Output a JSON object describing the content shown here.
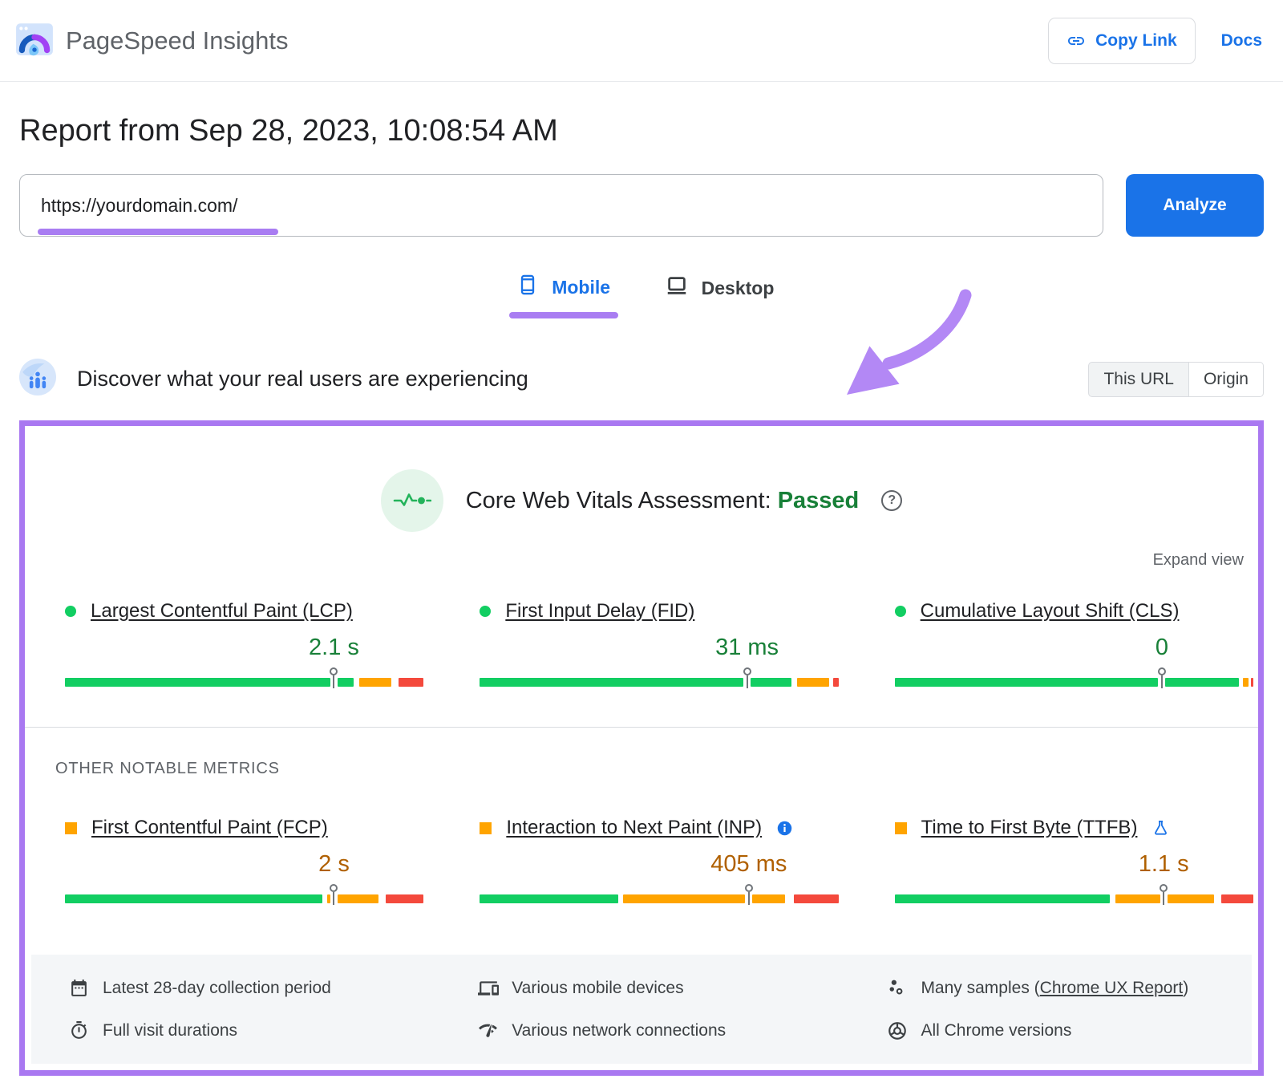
{
  "colors": {
    "accent_blue": "#1a73e8",
    "good_green": "#12ce62",
    "value_green": "#188038",
    "warn_orange": "#ffa400",
    "value_orange": "#b06000",
    "poor_red": "#f4493c",
    "annotation_purple": "#a97df2",
    "panel_border_purple": "#a978f1"
  },
  "header": {
    "app_title": "PageSpeed Insights",
    "copy_link_label": "Copy Link",
    "docs_label": "Docs"
  },
  "report": {
    "title": "Report from Sep 28, 2023, 10:08:54 AM",
    "url_value": "https://yourdomain.com/",
    "analyze_label": "Analyze"
  },
  "tabs": {
    "mobile_label": "Mobile",
    "desktop_label": "Desktop",
    "selected": "Mobile"
  },
  "discover": {
    "heading": "Discover what your real users are experiencing",
    "scope_this_url": "This URL",
    "scope_origin": "Origin",
    "selected_scope": "This URL"
  },
  "assessment": {
    "title": "Core Web Vitals Assessment:",
    "status": "Passed",
    "help_glyph": "?",
    "expand_label": "Expand view",
    "other_metrics_heading": "OTHER NOTABLE METRICS"
  },
  "metrics": {
    "core": [
      {
        "id": "lcp",
        "name": "Largest Contentful Paint (LCP)",
        "value": "2.1 s",
        "rating": "good",
        "marker_pct": 75,
        "icon": null,
        "segments": [
          {
            "color": "green",
            "from": 0,
            "to": 74
          },
          {
            "color": "green",
            "from": 76,
            "to": 80.5
          },
          {
            "color": "orange",
            "from": 82,
            "to": 91
          },
          {
            "color": "red",
            "from": 93,
            "to": 100
          }
        ]
      },
      {
        "id": "fid",
        "name": "First Input Delay (FID)",
        "value": "31 ms",
        "rating": "good",
        "marker_pct": 74.5,
        "icon": null,
        "segments": [
          {
            "color": "green",
            "from": 0,
            "to": 73.5
          },
          {
            "color": "green",
            "from": 75.5,
            "to": 87
          },
          {
            "color": "orange",
            "from": 88.5,
            "to": 97.5
          },
          {
            "color": "red",
            "from": 98.6,
            "to": 100
          }
        ]
      },
      {
        "id": "cls",
        "name": "Cumulative Layout Shift (CLS)",
        "value": "0",
        "rating": "good",
        "marker_pct": 74.5,
        "icon": null,
        "segments": [
          {
            "color": "green",
            "from": 0,
            "to": 73.5
          },
          {
            "color": "green",
            "from": 75.5,
            "to": 96
          },
          {
            "color": "orange",
            "from": 97,
            "to": 98.7
          },
          {
            "color": "red",
            "from": 99.3,
            "to": 100
          }
        ]
      }
    ],
    "other": [
      {
        "id": "fcp",
        "name": "First Contentful Paint (FCP)",
        "value": "2 s",
        "rating": "average",
        "marker_pct": 75,
        "icon": null,
        "segments": [
          {
            "color": "green",
            "from": 0,
            "to": 71.8
          },
          {
            "color": "orange",
            "from": 73,
            "to": 74
          },
          {
            "color": "orange",
            "from": 76,
            "to": 87.3
          },
          {
            "color": "red",
            "from": 89.5,
            "to": 100
          }
        ]
      },
      {
        "id": "inp",
        "name": "Interaction to Next Paint (INP)",
        "value": "405 ms",
        "rating": "average",
        "marker_pct": 75,
        "icon": "info-icon",
        "segments": [
          {
            "color": "green",
            "from": 0,
            "to": 38.5
          },
          {
            "color": "orange",
            "from": 40,
            "to": 74
          },
          {
            "color": "orange",
            "from": 76,
            "to": 85
          },
          {
            "color": "red",
            "from": 87.5,
            "to": 100
          }
        ]
      },
      {
        "id": "ttfb",
        "name": "Time to First Byte (TTFB)",
        "value": "1.1 s",
        "rating": "average",
        "marker_pct": 75,
        "icon": "flask-icon",
        "segments": [
          {
            "color": "green",
            "from": 0,
            "to": 60
          },
          {
            "color": "orange",
            "from": 61.5,
            "to": 74
          },
          {
            "color": "orange",
            "from": 76,
            "to": 89
          },
          {
            "color": "red",
            "from": 91,
            "to": 100
          }
        ]
      }
    ]
  },
  "footer_notes": {
    "columns": [
      [
        {
          "icon": "calendar-icon",
          "text": "Latest 28-day collection period"
        },
        {
          "icon": "stopwatch-icon",
          "text": "Full visit durations"
        }
      ],
      [
        {
          "icon": "devices-icon",
          "text": "Various mobile devices"
        },
        {
          "icon": "network-icon",
          "text": "Various network connections"
        }
      ],
      [
        {
          "icon": "samples-icon",
          "text": "Many samples (",
          "link": "Chrome UX Report",
          "suffix": ")"
        },
        {
          "icon": "chrome-icon",
          "text": "All Chrome versions"
        }
      ]
    ]
  }
}
